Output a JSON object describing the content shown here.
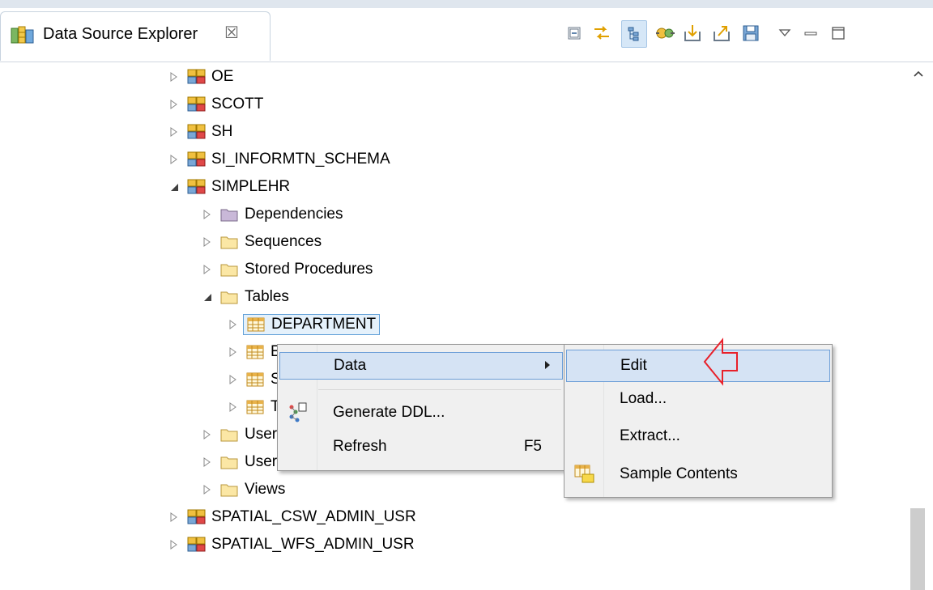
{
  "view": {
    "title": "Data Source Explorer",
    "close_glyph": "☒",
    "icon": "data-source-explorer-icon",
    "toolbar": [
      {
        "name": "collapse-all-icon"
      },
      {
        "name": "link-with-editor-icon"
      },
      {
        "name": "flat-layout-icon",
        "pressed": true
      },
      {
        "name": "connect-icon"
      },
      {
        "name": "import-icon"
      },
      {
        "name": "export-icon"
      },
      {
        "name": "save-icon"
      },
      {
        "name": "view-menu-icon"
      },
      {
        "name": "minimize-icon"
      },
      {
        "name": "maximize-icon"
      }
    ]
  },
  "tree": {
    "schemas_before": [
      "OE",
      "SCOTT",
      "SH",
      "SI_INFORMTN_SCHEMA"
    ],
    "expanded_schema": "SIMPLEHR",
    "folders": [
      "Dependencies",
      "Sequences",
      "Stored Procedures"
    ],
    "tables_folder": "Tables",
    "tables": [
      "DEPARTMENT",
      "E",
      "S",
      "T"
    ],
    "folders_after": [
      "User-",
      "User-Defined Types",
      "Views"
    ],
    "schemas_after": [
      "SPATIAL_CSW_ADMIN_USR",
      "SPATIAL_WFS_ADMIN_USR"
    ]
  },
  "context_menu": {
    "items": [
      {
        "label": "Data",
        "has_submenu": true,
        "highlighted": true
      },
      {
        "label": "Generate DDL...",
        "icon": "generate-ddl-icon"
      },
      {
        "label": "Refresh",
        "accelerator": "F5"
      }
    ]
  },
  "submenu": {
    "items": [
      {
        "label": "Edit",
        "highlighted": true
      },
      {
        "label": "Load..."
      },
      {
        "label": "Extract..."
      },
      {
        "label": "Sample Contents",
        "icon": "sample-contents-icon"
      }
    ]
  },
  "colors": {
    "selection": "#e5f1fb",
    "selection_border": "#62a0d8",
    "menu_bg": "#f0f0f0",
    "menu_highlight": "#d5e3f4",
    "annotation_arrow": "#e8202a"
  }
}
